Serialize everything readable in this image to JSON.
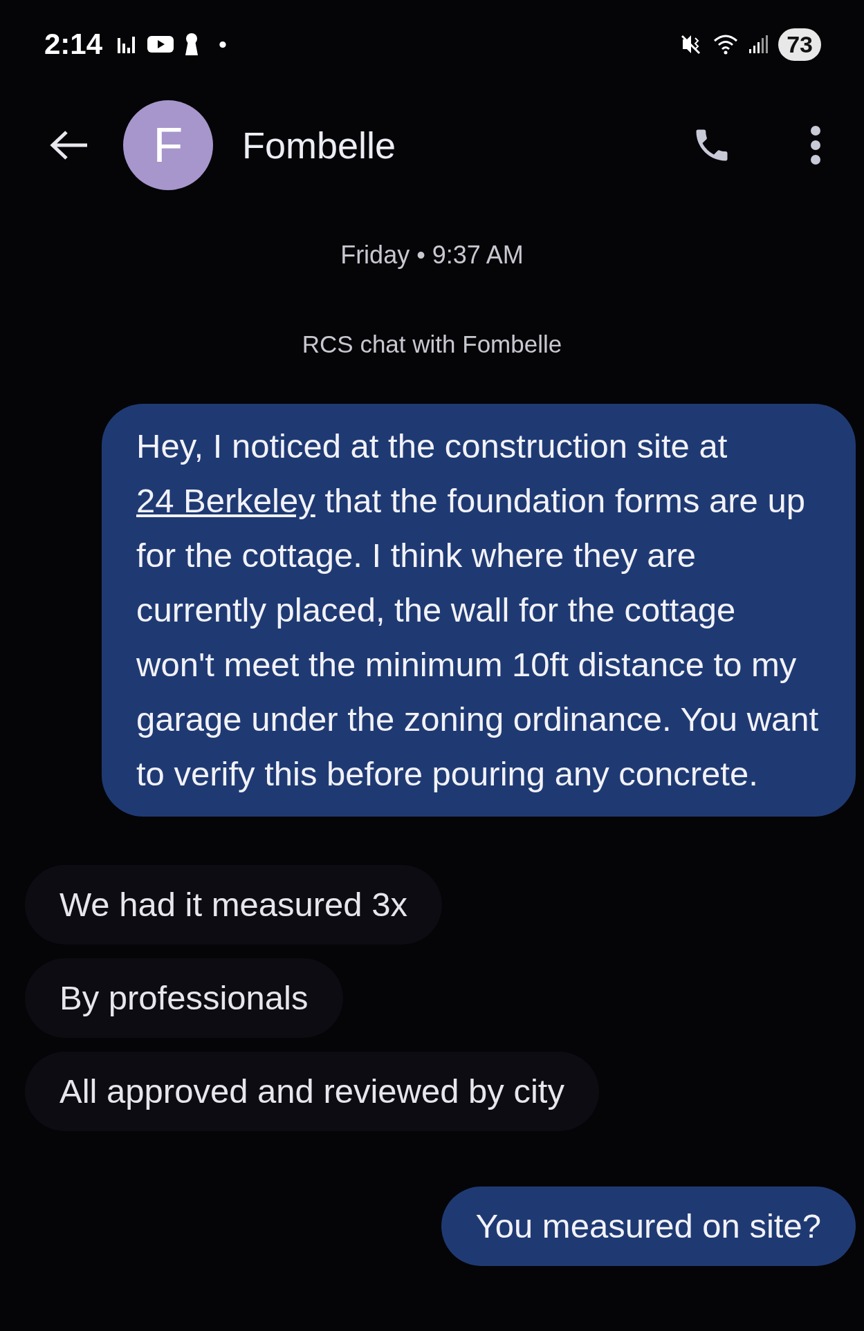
{
  "status_bar": {
    "time": "2:14",
    "dot": "•",
    "battery": "73"
  },
  "header": {
    "avatar_letter": "F",
    "contact_name": "Fombelle"
  },
  "conversation": {
    "date_stamp": "Friday • 9:37 AM",
    "chat_info": "RCS chat with Fombelle",
    "messages": [
      {
        "kind": "outgoing",
        "parts": [
          {
            "kind": "text",
            "text": "Hey, I noticed at the construction site at "
          },
          {
            "kind": "link",
            "text": "24 Berkeley"
          },
          {
            "kind": "text",
            "text": " that the foundation forms are up for the cottage. I think where they are currently placed, the wall for the cottage won't meet the minimum 10ft distance to my garage under the zoning ordinance. You want to verify this before pouring any concrete."
          }
        ]
      },
      {
        "kind": "incoming",
        "parts": [
          {
            "kind": "text",
            "text": "We had it measured 3x"
          }
        ]
      },
      {
        "kind": "incoming",
        "parts": [
          {
            "kind": "text",
            "text": "By professionals"
          }
        ]
      },
      {
        "kind": "incoming",
        "parts": [
          {
            "kind": "text",
            "text": "All approved and reviewed by city"
          }
        ]
      },
      {
        "kind": "outgoing",
        "parts": [
          {
            "kind": "text",
            "text": "You measured on site?"
          }
        ]
      }
    ]
  }
}
